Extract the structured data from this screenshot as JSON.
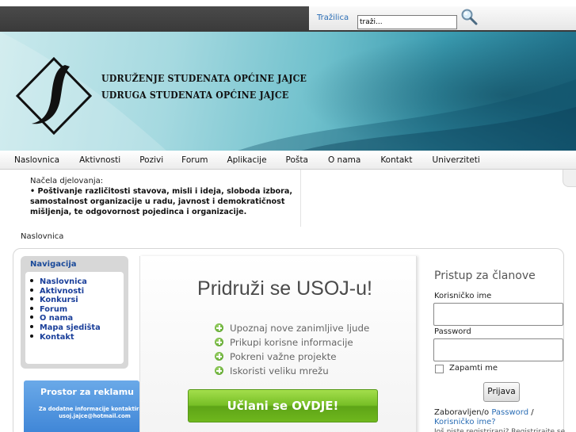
{
  "search": {
    "label": "Tražilica",
    "value": "traži..."
  },
  "site": {
    "title_line1": "UDRUŽENJE STUDENATA OPĆINE JAJCE",
    "title_line2": "UDRUGA STUDENATA OPĆINE JAJCE"
  },
  "nav": {
    "items": [
      {
        "label": "Naslovnica"
      },
      {
        "label": "Aktivnosti"
      },
      {
        "label": "Pozivi"
      },
      {
        "label": "Forum"
      },
      {
        "label": "Aplikacije"
      },
      {
        "label": "Pošta"
      },
      {
        "label": "O nama"
      },
      {
        "label": "Kontakt"
      },
      {
        "label": "Univerziteti"
      }
    ]
  },
  "info": {
    "label": "Načela djelovanja:",
    "text": "• Poštivanje različitosti stavova, misli i ideja, sloboda izbora, samostalnost organizacije u radu, javnost i demokratičnost mišljenja, te odgovornost pojedinca i organizacije."
  },
  "breadcrumb": "Naslovnica",
  "navigation_box": {
    "title": "Navigacija",
    "items": [
      {
        "label": "Naslovnica"
      },
      {
        "label": "Aktivnosti"
      },
      {
        "label": "Konkursi"
      },
      {
        "label": "Forum"
      },
      {
        "label": "O nama"
      },
      {
        "label": "Mapa sjedišta"
      },
      {
        "label": "Kontakt"
      }
    ]
  },
  "ad": {
    "title": "Prostor za reklamu",
    "text": "Za dodatne informacije kontaktirajte usoj.jajce@hotmail.com"
  },
  "join": {
    "title": "Pridruži se USOJ-u!",
    "benefits": [
      "Upoznaj nove zanimljive ljude",
      "Prikupi korisne informacije",
      "Pokreni važne projekte",
      "Iskoristi veliku mrežu"
    ],
    "button": "Učlani se OVDJE!"
  },
  "login": {
    "title": "Pristup za članove",
    "username_label": "Korisničko ime",
    "password_label": "Password",
    "remember_label": "Zapamti me",
    "submit": "Prijava",
    "forgot_prefix": "Zaboravljen/o ",
    "forgot_password": "Password",
    "forgot_sep": " / ",
    "forgot_username": "Korisničko ime?",
    "register_cut": "Još niste registrirani? Registrirajte se"
  },
  "colors": {
    "link": "#2a6db5",
    "nav_link": "#1a3f9a",
    "button_green": "#77bf26",
    "ad_blue": "#3d84d6"
  }
}
